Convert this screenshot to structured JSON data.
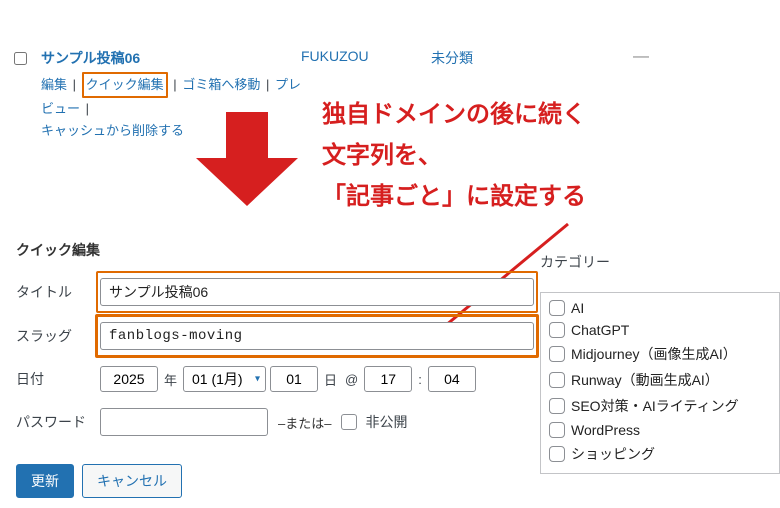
{
  "row": {
    "title": "サンプル投稿06",
    "author": "FUKUZOU",
    "category": "未分類",
    "date_dash": "—",
    "actions": {
      "edit": "編集",
      "quick_edit": "クイック編集",
      "trash": "ゴミ箱へ移動",
      "preview": "プレビュー",
      "purge_cache": "キャッシュから削除する"
    }
  },
  "annotation": {
    "line1": "独自ドメインの後に続く",
    "line2": "文字列を、",
    "line3": "「記事ごと」に設定する"
  },
  "qe": {
    "header": "クイック編集",
    "labels": {
      "title": "タイトル",
      "slug": "スラッグ",
      "date": "日付",
      "password": "パスワード",
      "categories": "カテゴリー"
    },
    "title_value": "サンプル投稿06",
    "slug_value": "fanblogs-moving",
    "date": {
      "year": "2025",
      "year_unit": "年",
      "month": "01 (1月)",
      "day": "01",
      "day_unit": "日",
      "at": "@",
      "hour": "17",
      "colon": ":",
      "minute": "04"
    },
    "password_value": "",
    "or": "–または–",
    "private_label": "非公開",
    "categories": [
      "AI",
      "ChatGPT",
      "Midjourney（画像生成AI）",
      "Runway（動画生成AI）",
      "SEO対策・AIライティング",
      "WordPress",
      "ショッピング"
    ]
  },
  "buttons": {
    "update": "更新",
    "cancel": "キャンセル"
  }
}
